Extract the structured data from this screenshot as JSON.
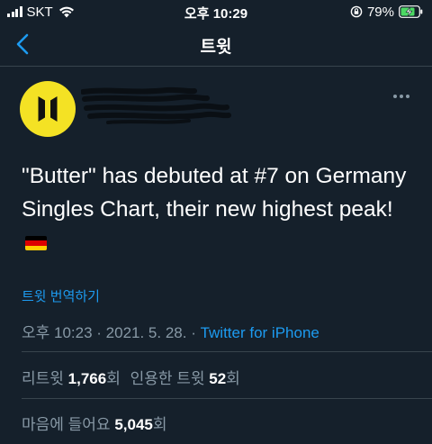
{
  "status_bar": {
    "carrier": "SKT",
    "time": "오후 10:29",
    "battery": "79%"
  },
  "nav": {
    "title": "트윗"
  },
  "tweet": {
    "text": "\"Butter\" has debuted at #7 on Germany Singles Chart, their new highest peak!",
    "flag": "germany-flag",
    "translate": "트윗 번역하기",
    "time": "오후 10:23",
    "sep1": " · ",
    "date": "2021. 5. 28.",
    "sep2": " · ",
    "source": "Twitter for iPhone"
  },
  "stats": {
    "retweet_label": "리트윗",
    "retweet_count": "1,766",
    "retweet_unit": "회",
    "quote_label": "인용한 트윗",
    "quote_count": "52",
    "quote_unit": "회",
    "like_label": "마음에 들어요",
    "like_count": "5,045",
    "like_unit": "회"
  },
  "colors": {
    "background": "#15202b",
    "accent": "#1d9bf0",
    "secondary_text": "#8899a6",
    "divider": "#38444d",
    "avatar_bg": "#f4e224"
  }
}
